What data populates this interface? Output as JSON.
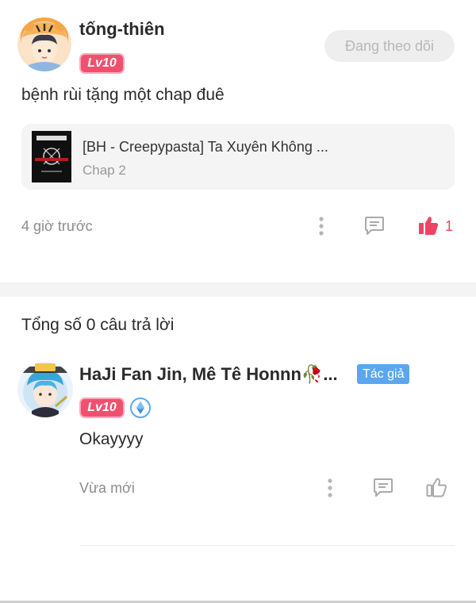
{
  "post": {
    "username": "tống-thiên",
    "level": "Lv10",
    "follow_label": "Đang theo dõi",
    "text": "bệnh rùi tặng một chap đuê",
    "chapter": {
      "title": "[BH - Creepypasta] Ta Xuyên Không ...",
      "subtitle": "Chap 2"
    },
    "time": "4 giờ trước",
    "like_count": "1",
    "icons": {
      "more": "more-vertical-icon",
      "comment": "comment-icon",
      "like": "thumbs-up-icon"
    },
    "colors": {
      "like_active": "#ee4466",
      "level_badge": "#f0506e"
    }
  },
  "replies": {
    "count_label": "Tổng số 0 câu trả lời",
    "items": [
      {
        "username": "HaJi Fan Jin, Mê Tê Honnn🥀...",
        "author_badge": "Tác giả",
        "level": "Lv10",
        "text": "Okayyyy",
        "time": "Vừa mới"
      }
    ],
    "colors": {
      "author_badge": "#5aa7f0"
    }
  }
}
